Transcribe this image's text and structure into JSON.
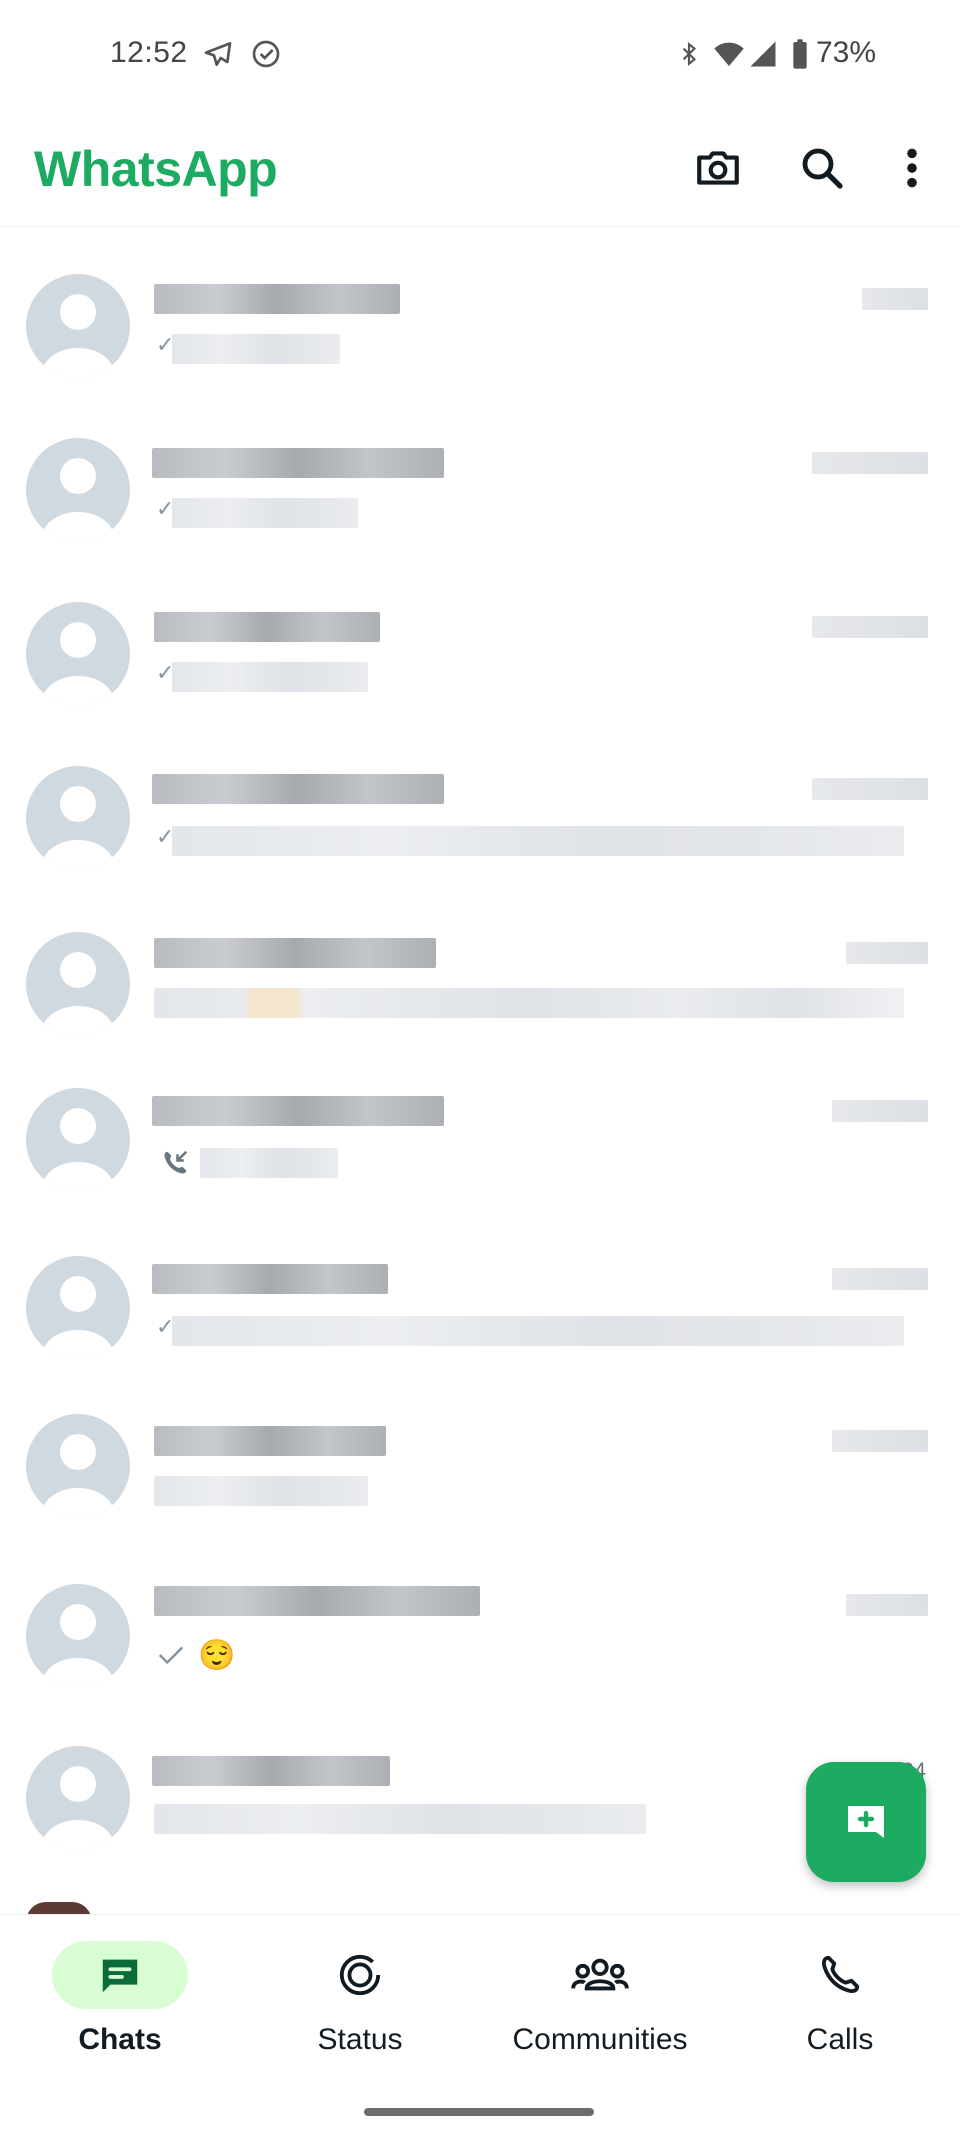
{
  "status_bar": {
    "time": "12:52",
    "battery": "73%"
  },
  "app_bar": {
    "title": "WhatsApp"
  },
  "chats": [
    {
      "preview_icon": "single-tick",
      "time": ""
    },
    {
      "preview_icon": "single-tick",
      "time": ""
    },
    {
      "preview_icon": "single-tick",
      "time": ""
    },
    {
      "preview_icon": "single-tick",
      "time": ""
    },
    {
      "preview_icon": "none",
      "time": ""
    },
    {
      "preview_icon": "missed-call",
      "time": ""
    },
    {
      "preview_icon": "single-tick",
      "time": ""
    },
    {
      "preview_icon": "none",
      "time": ""
    },
    {
      "preview_icon": "double-tick-grey",
      "preview_emoji": "😌",
      "time": ""
    },
    {
      "preview_icon": "none",
      "time": "2/5/24"
    }
  ],
  "bottom_nav": {
    "items": [
      {
        "label": "Chats",
        "active": true
      },
      {
        "label": "Status",
        "active": false
      },
      {
        "label": "Communities",
        "active": false
      },
      {
        "label": "Calls",
        "active": false
      }
    ]
  },
  "colors": {
    "brand": "#1daa61",
    "active_pill": "#d8fdd2"
  }
}
